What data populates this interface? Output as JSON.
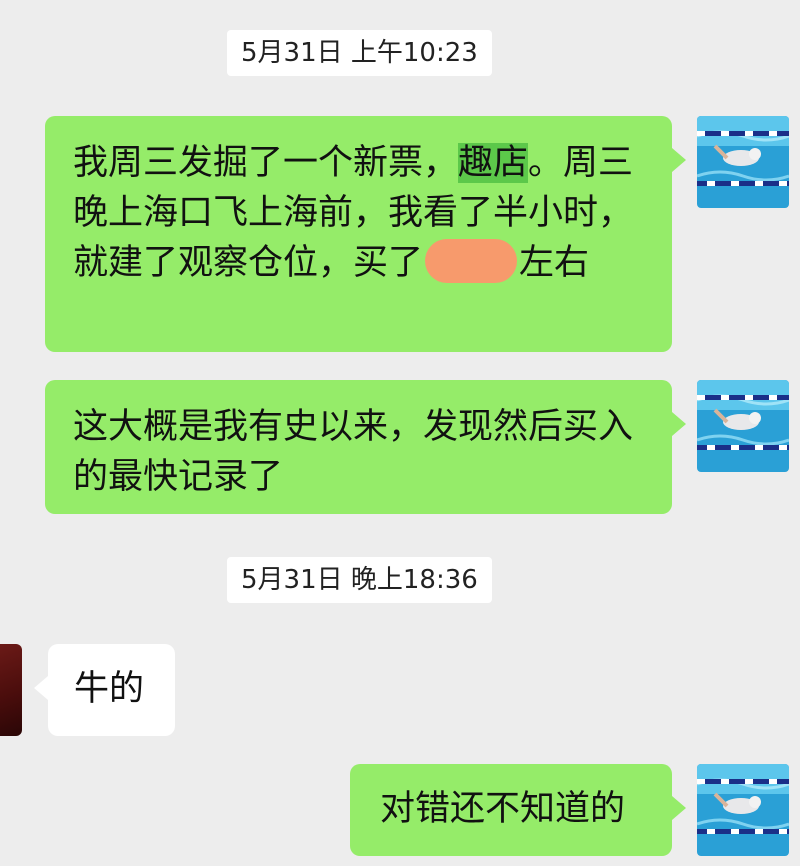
{
  "timestamps": [
    "5月31日 上午10:23",
    "5月31日 晚上18:36"
  ],
  "messages": [
    {
      "direction": "out",
      "before_highlight": "我周三发掘了一个新票，",
      "highlight": "趣店",
      "middle": "。周三晚上海口飞上海前，我看了半小时，就建了观察仓位，买了",
      "after_redaction": "左右"
    },
    {
      "direction": "out",
      "text": "这大概是我有史以来，发现然后买入的最快记录了"
    },
    {
      "direction": "in",
      "text": "牛的"
    },
    {
      "direction": "out",
      "text": "对错还不知道的"
    }
  ],
  "avatars": {
    "self": "swimmer-avatar",
    "other": "contact-avatar"
  },
  "colors": {
    "background": "#ededed",
    "outgoing_bubble": "#95ec69",
    "incoming_bubble": "#ffffff",
    "highlight": "#5cc84a",
    "redaction": "#f79a6c"
  }
}
